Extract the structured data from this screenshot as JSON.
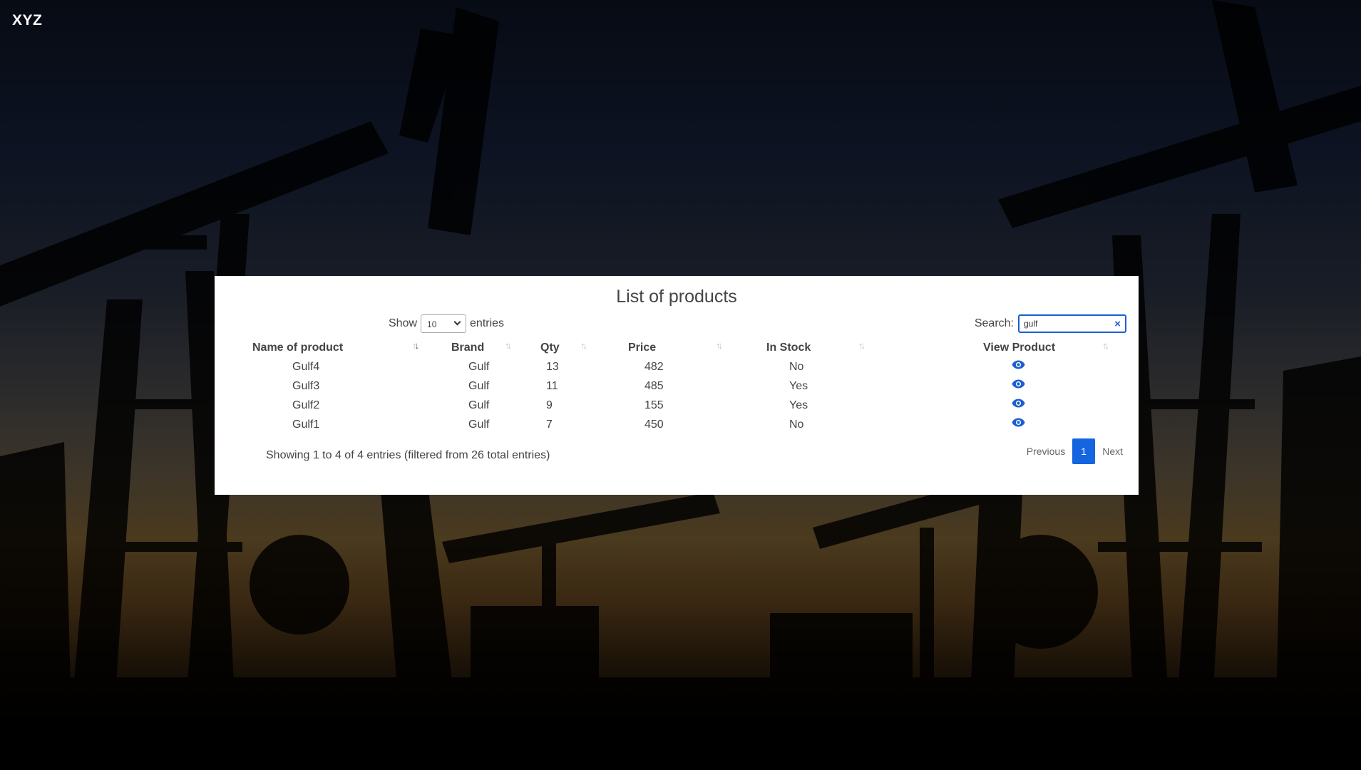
{
  "app": {
    "brand": "XYZ"
  },
  "panel": {
    "title": "List of products",
    "length": {
      "show_label": "Show",
      "selected": "10",
      "entries_label": "entries"
    },
    "search": {
      "label": "Search:",
      "value": "gulf",
      "clear": "×"
    },
    "columns": [
      "Name of product",
      "Brand",
      "Qty",
      "Price",
      "In Stock",
      "View Product"
    ],
    "rows": [
      {
        "name": "Gulf4",
        "brand": "Gulf",
        "qty": "13",
        "price": "482",
        "stock": "No"
      },
      {
        "name": "Gulf3",
        "brand": "Gulf",
        "qty": "11",
        "price": "485",
        "stock": "Yes"
      },
      {
        "name": "Gulf2",
        "brand": "Gulf",
        "qty": "9",
        "price": "155",
        "stock": "Yes"
      },
      {
        "name": "Gulf1",
        "brand": "Gulf",
        "qty": "7",
        "price": "450",
        "stock": "No"
      }
    ],
    "info": "Showing 1 to 4 of 4 entries (filtered from 26 total entries)",
    "pagination": {
      "previous": "Previous",
      "current": "1",
      "next": "Next"
    }
  },
  "colors": {
    "accent": "#1565e0",
    "eye_icon": "#1a5fd1",
    "panel_bg": "#ffffff"
  },
  "icons": {
    "view": "eye-icon",
    "sort": "sort-arrows-icon",
    "clear": "close-icon",
    "dropdown": "chevron-down-icon"
  }
}
